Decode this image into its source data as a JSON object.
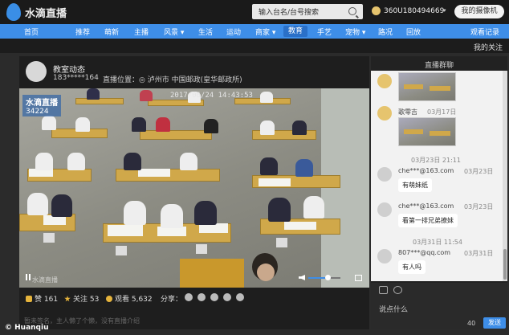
{
  "header": {
    "logo_text": "水滴直播",
    "search_placeholder": "输入台名/台号搜索",
    "user_id": "360U180494669",
    "user_chevron": "▾",
    "mycam_button": "我的摄像机"
  },
  "nav": {
    "items": [
      "首页",
      "推荐",
      "萌新",
      "主播",
      "风景",
      "生活",
      "运动",
      "商家",
      "教育",
      "手艺",
      "宠物",
      "路况",
      "回放"
    ],
    "dropdown_marks": [
      "风景",
      "商家",
      "宠物"
    ],
    "active": "教育",
    "history": "观看记录",
    "my_follow": "我的关注"
  },
  "room": {
    "title": "教室动态",
    "owner": "183*****164",
    "location": "直播位置：◎ 泸州市 中国邮政(皇华邮政所)"
  },
  "video": {
    "cam_name": "水滴直播",
    "cam_views": "34224",
    "timestamp": "2017/06/24 14:43:53",
    "bottom_watermark": "水滴直播",
    "volume_level": 0.6
  },
  "stats": {
    "likes": "赞 161",
    "follows": "关注 53",
    "views": "观看 5,632",
    "share_label": "分享："
  },
  "description": "暂未签名，主人懒了个懒，没有直播介绍",
  "chat": {
    "title": "直播群聊",
    "messages": [
      {
        "name": "",
        "time": "",
        "text": ""
      },
      {
        "name": "歌零吉",
        "time": "03月17日",
        "text": ""
      },
      {
        "name": "",
        "time": "03月23日 21:11",
        "text": ""
      },
      {
        "name": "che***@163.com",
        "time": "03月23日",
        "text": "有萌妹纸"
      },
      {
        "name": "che***@163.com",
        "time": "03月23日",
        "text": "看第一排兄弟撩妹"
      },
      {
        "name": "",
        "time": "03月31日 11:54",
        "text": ""
      },
      {
        "name": "807***@qq.com",
        "time": "03月31日",
        "text": "有人吗"
      }
    ],
    "input_placeholder": "说点什么",
    "char_count": "40",
    "send_label": "发送"
  },
  "credit": "© Huanqiu",
  "colors": {
    "nav_blue": "#3e8ee8",
    "header_bg": "#1a1a1a",
    "send_blue": "#3e8ee8"
  }
}
